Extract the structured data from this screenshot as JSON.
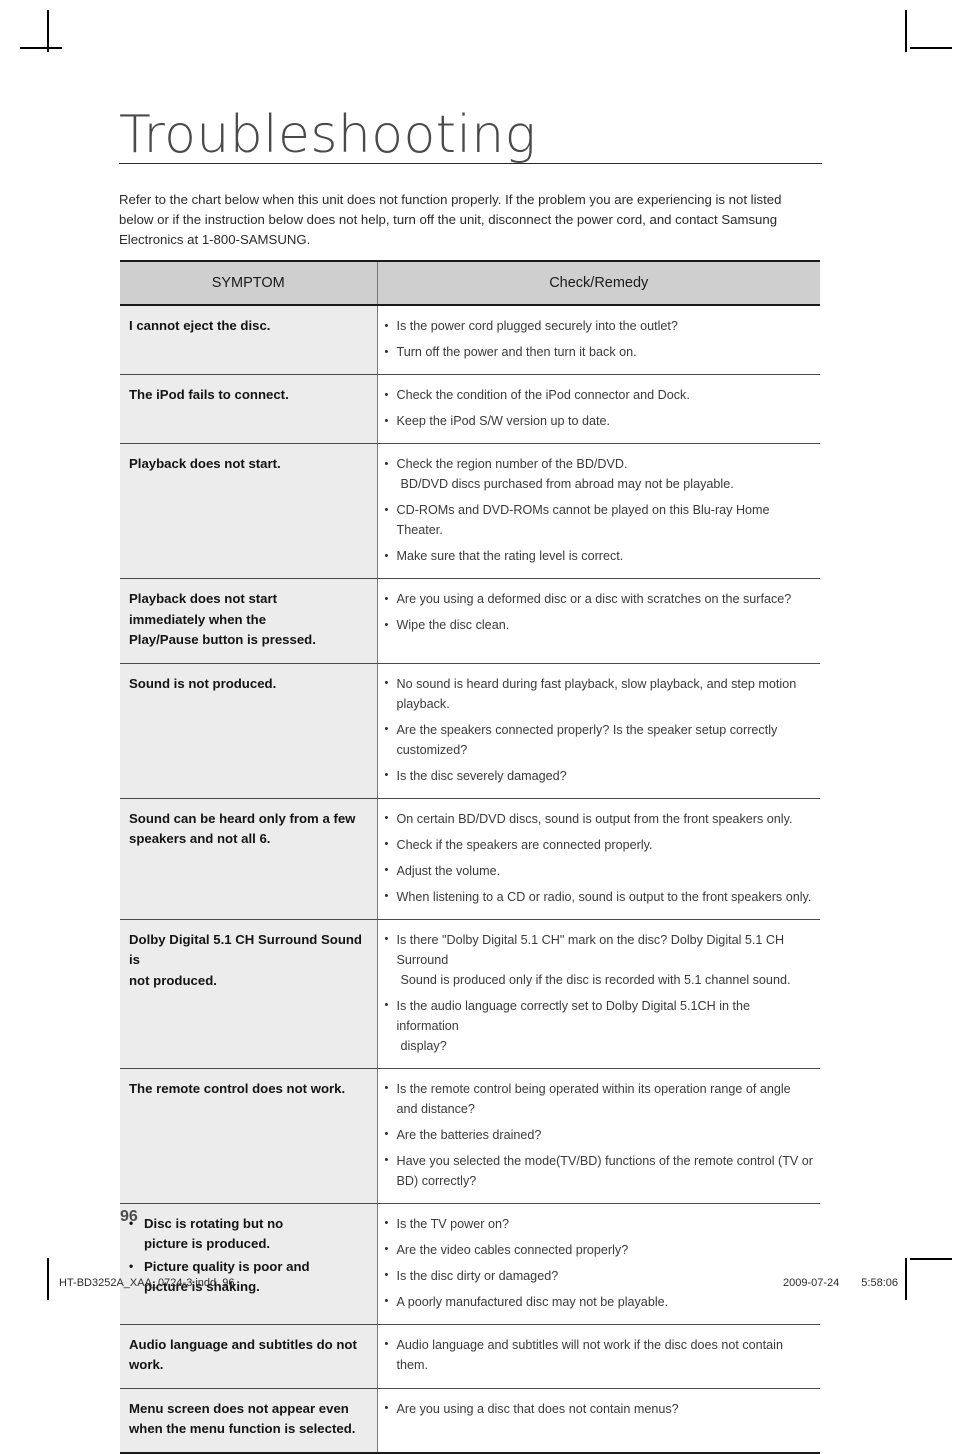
{
  "document": {
    "title": "Troubleshooting",
    "intro": "Refer to the chart below when this unit does not function properly. If the problem you are experiencing is not listed below or if the instruction below does not help, turn off the unit, disconnect the power cord, and contact Samsung Electronics at 1-800-SAMSUNG.",
    "page_number": "96"
  },
  "table": {
    "headers": {
      "symptom": "SYMPTOM",
      "remedy": "Check/Remedy"
    },
    "rows": [
      {
        "symptom_lines": [
          "I cannot eject the disc."
        ],
        "symptom_bulleted": false,
        "remedies": [
          "Is the power cord plugged securely into the outlet?",
          "Turn off the power and then turn it back on."
        ]
      },
      {
        "symptom_lines": [
          "The iPod fails to connect."
        ],
        "symptom_bulleted": false,
        "remedies": [
          "Check the condition of the iPod connector and Dock.",
          "Keep the iPod S/W version up to date."
        ]
      },
      {
        "symptom_lines": [
          "Playback does not start."
        ],
        "symptom_bulleted": false,
        "remedies": [
          "Check the region number of the BD/DVD.\nBD/DVD discs purchased from abroad may not be playable.",
          "CD-ROMs and DVD-ROMs cannot be played on this Blu-ray Home Theater.",
          "Make sure that the rating level is correct."
        ]
      },
      {
        "symptom_lines": [
          "Playback does not start",
          "immediately when the",
          "Play/Pause button is pressed."
        ],
        "symptom_bulleted": false,
        "remedies": [
          "Are you using a deformed disc or a disc with scratches on the surface?",
          "Wipe the disc clean."
        ]
      },
      {
        "symptom_lines": [
          "Sound is not produced."
        ],
        "symptom_bulleted": false,
        "remedies": [
          "No sound is heard during fast playback, slow playback, and step motion playback.",
          "Are the speakers connected properly? Is the speaker setup correctly customized?",
          "Is the disc severely damaged?"
        ]
      },
      {
        "symptom_lines": [
          "Sound can be heard only from a few",
          "speakers and not all 6."
        ],
        "symptom_bulleted": false,
        "remedies": [
          "On certain BD/DVD discs, sound is output from the front speakers only.",
          "Check if the speakers are connected properly.",
          "Adjust the volume.",
          "When listening to a CD or radio, sound is output to the front speakers only."
        ]
      },
      {
        "symptom_lines": [
          "Dolby Digital 5.1 CH Surround Sound is",
          "not produced."
        ],
        "symptom_bulleted": false,
        "remedies": [
          "Is there \"Dolby Digital 5.1 CH\" mark on the disc? Dolby Digital 5.1 CH Surround\nSound is produced only if the disc is recorded with 5.1 channel sound.",
          "Is the audio language correctly set to Dolby Digital 5.1CH in the information\ndisplay?"
        ]
      },
      {
        "symptom_lines": [
          "The remote control does not work."
        ],
        "symptom_bulleted": false,
        "remedies": [
          "Is the remote control being operated within its operation range of angle and distance?",
          "Are the batteries drained?",
          "Have you selected the mode(TV/BD) functions of the remote control (TV or BD) correctly?"
        ]
      },
      {
        "symptom_bulleted": true,
        "symptom_bullets": [
          "Disc is rotating but no\npicture is produced.",
          "Picture quality is poor and\npicture is shaking."
        ],
        "remedies": [
          "Is the TV power on?",
          "Are the video cables connected properly?",
          "Is the disc dirty or damaged?",
          "A poorly manufactured disc may not be playable."
        ]
      },
      {
        "symptom_lines": [
          "Audio language and subtitles do not work."
        ],
        "symptom_bulleted": false,
        "remedies": [
          "Audio language and subtitles will not work if the disc does not contain them."
        ]
      },
      {
        "symptom_lines": [
          "Menu screen does not appear even",
          "when the menu function is selected."
        ],
        "symptom_bulleted": false,
        "remedies": [
          "Are you using a disc that does not contain menus?"
        ]
      }
    ]
  },
  "footer": {
    "file": "HT-BD3252A_XAA_0724-3.indd",
    "page": "96",
    "date": "2009-07-24",
    "time": "5:58:06"
  }
}
